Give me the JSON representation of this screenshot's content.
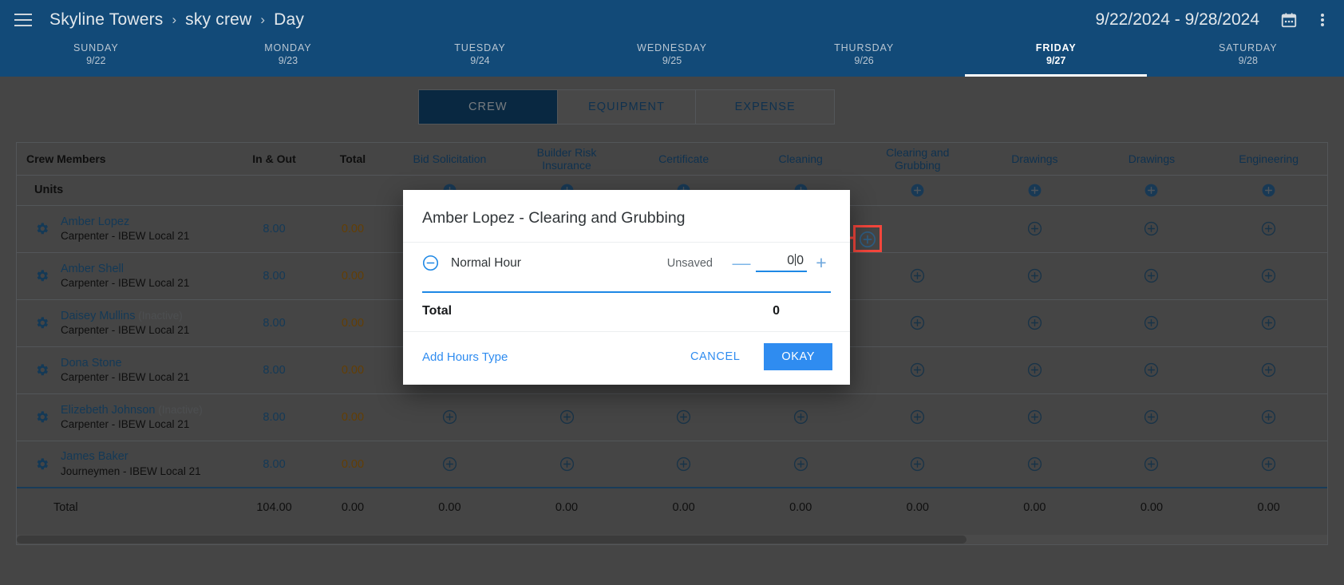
{
  "topbar": {
    "menu_icon": "hamburger-menu-icon",
    "breadcrumb": [
      "Skyline Towers",
      "sky crew",
      "Day"
    ],
    "separator": "›",
    "date_range": "9/22/2024 - 9/28/2024",
    "calendar_icon": "calendar-icon",
    "overflow_icon": "kebab-menu-icon"
  },
  "week": [
    {
      "name": "SUNDAY",
      "date": "9/22",
      "active": false
    },
    {
      "name": "MONDAY",
      "date": "9/23",
      "active": false
    },
    {
      "name": "TUESDAY",
      "date": "9/24",
      "active": false
    },
    {
      "name": "WEDNESDAY",
      "date": "9/25",
      "active": false
    },
    {
      "name": "THURSDAY",
      "date": "9/26",
      "active": false
    },
    {
      "name": "FRIDAY",
      "date": "9/27",
      "active": true
    },
    {
      "name": "SATURDAY",
      "date": "9/28",
      "active": false
    }
  ],
  "tabs": [
    {
      "label": "CREW",
      "active": true
    },
    {
      "label": "EQUIPMENT",
      "active": false
    },
    {
      "label": "EXPENSE",
      "active": false
    }
  ],
  "table": {
    "headers": {
      "name": "Crew Members",
      "in_out": "In & Out",
      "total": "Total",
      "tasks": [
        "Bid Solicitation",
        "Builder Risk Insurance",
        "Certificate",
        "Cleaning",
        "Clearing and Grubbing",
        "Drawings",
        "Drawings",
        "Engineering"
      ]
    },
    "units_row": {
      "label": "Units",
      "in_out": "",
      "total": "",
      "cells": [
        "+",
        "+",
        "+",
        "+",
        "+",
        "+",
        "+",
        "+"
      ]
    },
    "rows": [
      {
        "name": "Amber Lopez",
        "inactive": "",
        "role": "Carpenter - IBEW Local 21",
        "in_out": "8.00",
        "total": "0.00"
      },
      {
        "name": "Amber Shell",
        "inactive": "",
        "role": "Carpenter - IBEW Local 21",
        "in_out": "8.00",
        "total": "0.00"
      },
      {
        "name": "Daisey Mullins",
        "inactive": "(Inactive)",
        "role": "Carpenter - IBEW Local 21",
        "in_out": "8.00",
        "total": "0.00"
      },
      {
        "name": "Dona Stone",
        "inactive": "",
        "role": "Carpenter - IBEW Local 21",
        "in_out": "8.00",
        "total": "0.00"
      },
      {
        "name": "Elizebeth Johnson",
        "inactive": "(Inactive)",
        "role": "Carpenter - IBEW Local 21",
        "in_out": "8.00",
        "total": "0.00"
      },
      {
        "name": "James Baker",
        "inactive": "",
        "role": "Journeymen - IBEW Local 21",
        "in_out": "8.00",
        "total": "0.00"
      }
    ],
    "total_row": {
      "label": "Total",
      "in_out": "104.00",
      "total": "0.00",
      "task_values": [
        "0.00",
        "0.00",
        "0.00",
        "0.00",
        "0.00",
        "0.00",
        "0.00",
        "0.00"
      ]
    }
  },
  "dialog": {
    "title": "Amber Lopez - Clearing and Grubbing",
    "remove_icon": "minus-circle-icon",
    "hour_type": "Normal Hour",
    "status": "Unsaved",
    "stepper": {
      "decrement": "—",
      "increment": "+",
      "value_before_caret": "0",
      "value_after_caret": "0"
    },
    "total_label": "Total",
    "total_value": "0",
    "add_hours_type": "Add Hours Type",
    "cancel_label": "CANCEL",
    "okay_label": "OKAY"
  },
  "annotation": {
    "highlight_color": "#f4463c",
    "target_icon": "plus-circle-icon",
    "arrow_icon": "left-arrow-annotation-icon"
  },
  "colors": {
    "brand_blue": "#124A78",
    "link_blue": "#2569a0",
    "accent_blue": "#2f8cf0",
    "amber": "#b5740a",
    "scrim": "#000000"
  }
}
